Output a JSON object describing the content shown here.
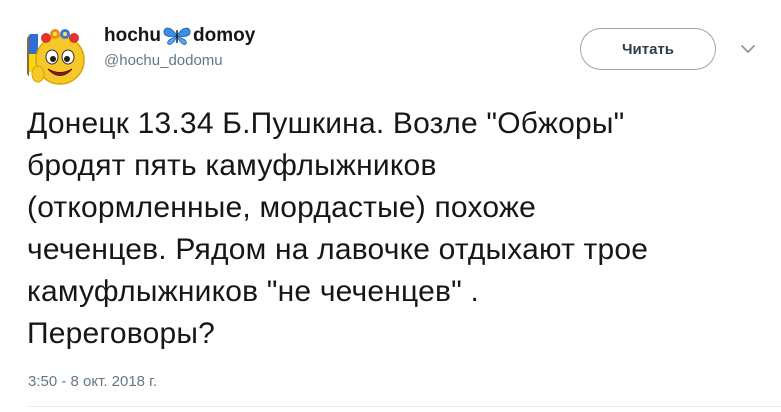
{
  "user": {
    "display_name_part1": "hochu",
    "display_name_part2": "domoy",
    "handle": "@hochu_dodomu"
  },
  "follow_button": {
    "label": "Читать"
  },
  "tweet": {
    "text": "Донецк 13.34  Б.Пушкина. Возле \"Обжоры\"\nбродят пять камуфлыжников\n(откормленные, мордастые) похоже\nчеченцев. Рядом на лавочке отдыхают трое\nкамуфлыжников \"не чеченцев\" .\nПереговоры?",
    "timestamp": "3:50 - 8 окт. 2018 г."
  },
  "colors": {
    "accent": "#1da1f2",
    "text": "#14171a",
    "secondary": "#657786",
    "butterfly": "#3b8ee0"
  },
  "icons": {
    "avatar": "smiley-face-avatar",
    "name_emoji": "butterfly-icon",
    "menu": "chevron-down-icon"
  }
}
